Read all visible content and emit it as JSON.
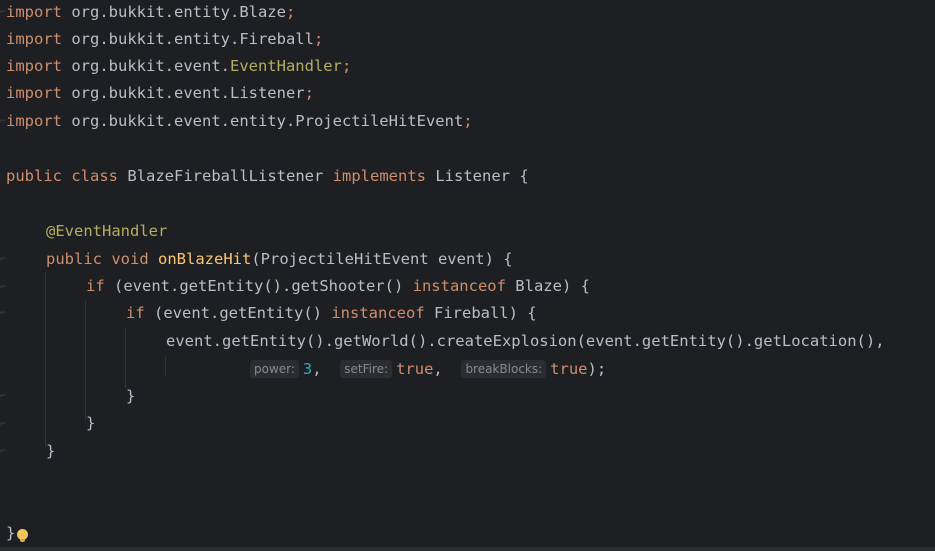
{
  "editor": {
    "imports": [
      {
        "keyword": "import",
        "path": "org.bukkit.entity.Blaze",
        "semi": ";"
      },
      {
        "keyword": "import",
        "path": "org.bukkit.entity.Fireball",
        "semi": ";"
      },
      {
        "keyword": "import",
        "path_prefix": "org.bukkit.event.",
        "path_highlight": "EventHandler",
        "semi": ";"
      },
      {
        "keyword": "import",
        "path": "org.bukkit.event.Listener",
        "semi": ";"
      },
      {
        "keyword": "import",
        "path": "org.bukkit.event.entity.ProjectileHitEvent",
        "semi": ";"
      }
    ],
    "class_decl": {
      "kw_public": "public",
      "kw_class": "class",
      "name": "BlazeFireballListener",
      "kw_implements": "implements",
      "iface": "Listener",
      "brace": "{"
    },
    "annotation": "@EventHandler",
    "method_decl": {
      "kw_public": "public",
      "kw_void": "void",
      "name": "onBlazeHit",
      "params": "(ProjectileHitEvent event) {"
    },
    "if1": {
      "kw_if": "if",
      "cond_a": "(event.getEntity().getShooter() ",
      "kw_instanceof": "instanceof",
      "cond_b": " Blaze) {"
    },
    "if2": {
      "kw_if": "if",
      "cond_a": "(event.getEntity() ",
      "kw_instanceof": "instanceof",
      "cond_b": " Fireball) {"
    },
    "call_line": "event.getEntity().getWorld().createExplosion(event.getEntity().getLocation(),",
    "args_line": {
      "hint_power": "power:",
      "val_power": "3",
      "sep1": ",",
      "hint_setfire": "setFire:",
      "val_setfire": "true",
      "sep2": ",",
      "hint_break": "breakBlocks:",
      "val_break": "true",
      "end": ");"
    },
    "close_brace": "}",
    "final_brace": "}"
  },
  "colors": {
    "background": "#1e1f22",
    "keyword": "#cf8e6d",
    "annotation": "#b3ae60",
    "method_name": "#ffc66d",
    "number": "#2aacb8",
    "text": "#bcbec4"
  },
  "icons": {
    "intention": "lightbulb-icon"
  }
}
